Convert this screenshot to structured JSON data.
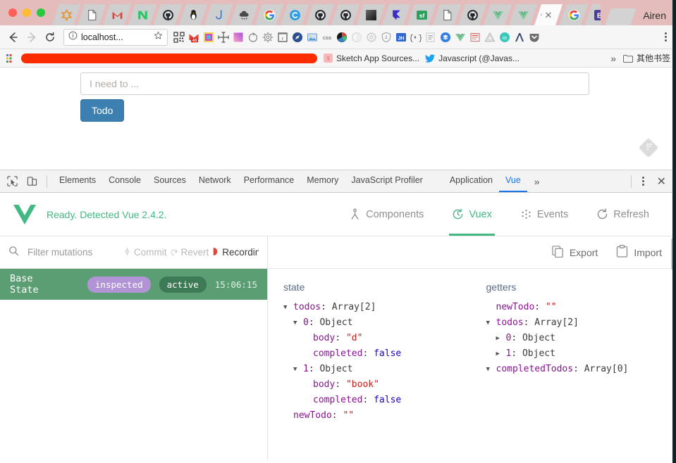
{
  "browser": {
    "profile_label": "Airen",
    "tabs": [
      {
        "icon": "slack-icon",
        "active": false
      },
      {
        "icon": "document-icon",
        "active": false
      },
      {
        "icon": "gmail-m-icon",
        "active": false
      },
      {
        "icon": "medium-n-icon",
        "active": false
      },
      {
        "icon": "github-icon",
        "active": false
      },
      {
        "icon": "penguin-icon",
        "active": false
      },
      {
        "icon": "moon-icon",
        "active": false
      },
      {
        "icon": "cloud-icon",
        "active": false
      },
      {
        "icon": "google-g-icon",
        "active": false
      },
      {
        "icon": "c-circle-icon",
        "active": false
      },
      {
        "icon": "github-icon",
        "active": false
      },
      {
        "icon": "github-icon",
        "active": false
      },
      {
        "icon": "dark-square-icon",
        "active": false
      },
      {
        "icon": "framer-f-icon",
        "active": false
      },
      {
        "icon": "sf-green-icon",
        "active": false
      },
      {
        "icon": "document-icon",
        "active": false
      },
      {
        "icon": "github-icon",
        "active": false
      },
      {
        "icon": "vue-icon",
        "active": false
      },
      {
        "icon": "vue-icon",
        "active": false
      },
      {
        "icon": "close-icon",
        "active": true
      },
      {
        "icon": "google-g-icon",
        "active": false
      },
      {
        "icon": "b-purple-icon",
        "active": false
      },
      {
        "icon": "document-icon",
        "active": false
      },
      {
        "icon": "w3c-icon",
        "active": false
      }
    ],
    "nav": {
      "back": "back-arrow-icon",
      "forward": "forward-arrow-icon",
      "reload": "reload-icon",
      "url": "localhost...",
      "info_icon": "info-circle-icon",
      "star_icon": "star-icon",
      "menu_icon": "kebab-menu-icon"
    },
    "extensions": [
      "qr-code-icon",
      "gmail-badge-icon",
      "colorpicker-icon",
      "crosshair-icon",
      "gradient-icon",
      "refresh-circle-icon",
      "gear-icon",
      "ruler-icon",
      "compass-icon",
      "image-icon",
      "css-icon",
      "color-wheel-icon",
      "half-circle-icon",
      "atom-icon",
      "shield-icon",
      "jh-icon",
      "braces-icon",
      "list-icon",
      "layers-blue-icon",
      "vue-icon",
      "note-icon",
      "triangle-icon",
      "m-circle-icon",
      "lambda-icon",
      "pocket-icon"
    ],
    "gmail_badge": "43",
    "bookmarks": {
      "redacted_label": "",
      "items": [
        {
          "label": "Sketch App Sources...",
          "icon": "sketch-icon"
        },
        {
          "label": "Javascript (@Javas...",
          "icon": "twitter-icon"
        }
      ],
      "overflow": "»",
      "other_label": "其他书签",
      "other_icon": "folder-icon"
    }
  },
  "page": {
    "input_placeholder": "I need to ...",
    "input_value": "",
    "submit_label": "Todo",
    "watermark_icon": "feedly-icon"
  },
  "devtools": {
    "inspect_icon": "inspect-cursor-icon",
    "device_icon": "device-toolbar-icon",
    "tabs": [
      {
        "label": "Elements",
        "selected": false
      },
      {
        "label": "Console",
        "selected": false
      },
      {
        "label": "Sources",
        "selected": false
      },
      {
        "label": "Network",
        "selected": false
      },
      {
        "label": "Performance",
        "selected": false
      },
      {
        "label": "Memory",
        "selected": false
      },
      {
        "label": "JavaScript Profiler",
        "selected": false
      },
      {
        "label": "Application",
        "selected": false
      },
      {
        "label": "Vue",
        "selected": true
      }
    ],
    "more_tabs": "»",
    "settings_icon": "kebab-menu-icon",
    "close_icon": "close-icon",
    "close_label": "✕"
  },
  "vue": {
    "logo_icon": "vue-logo-icon",
    "status": "Ready. Detected Vue 2.4.2.",
    "tabs": [
      {
        "label": "Components",
        "icon": "components-icon",
        "selected": false
      },
      {
        "label": "Vuex",
        "icon": "vuex-clock-icon",
        "selected": true
      },
      {
        "label": "Events",
        "icon": "events-icon",
        "selected": false
      },
      {
        "label": "Refresh",
        "icon": "refresh-icon",
        "selected": false
      }
    ]
  },
  "vuex": {
    "filter": {
      "icon": "search-icon",
      "placeholder": "Filter mutations",
      "value": ""
    },
    "actions": [
      {
        "label": "Commit",
        "icon": "commit-icon",
        "enabled": false
      },
      {
        "label": "Revert",
        "icon": "revert-icon",
        "enabled": false
      },
      {
        "label": "Recordin",
        "icon": "recording-icon",
        "enabled": true
      }
    ],
    "toolbar_right": [
      {
        "label": "Export",
        "icon": "export-icon"
      },
      {
        "label": "Import",
        "icon": "import-icon"
      }
    ],
    "history": [
      {
        "name": "Base State",
        "badges": [
          {
            "label": "inspected",
            "kind": "inspected"
          },
          {
            "label": "active",
            "kind": "active"
          }
        ],
        "time": "15:06:15",
        "selected": true
      }
    ],
    "state_pane": {
      "title": "state",
      "nodes": [
        {
          "indent": 0,
          "arrow": "down",
          "key": "todos",
          "sep": ": ",
          "value": "Array[2]",
          "vclass": "v-arr"
        },
        {
          "indent": 1,
          "arrow": "down",
          "key": "0",
          "sep": ": ",
          "value": "Object",
          "vclass": "v-obj"
        },
        {
          "indent": 2,
          "arrow": "none",
          "key": "body",
          "sep": ": ",
          "value": "\"d\"",
          "vclass": "v-str"
        },
        {
          "indent": 2,
          "arrow": "none",
          "key": "completed",
          "sep": ": ",
          "value": "false",
          "vclass": "v-bool"
        },
        {
          "indent": 1,
          "arrow": "down",
          "key": "1",
          "sep": ": ",
          "value": "Object",
          "vclass": "v-obj"
        },
        {
          "indent": 2,
          "arrow": "none",
          "key": "body",
          "sep": ": ",
          "value": "\"book\"",
          "vclass": "v-str"
        },
        {
          "indent": 2,
          "arrow": "none",
          "key": "completed",
          "sep": ": ",
          "value": "false",
          "vclass": "v-bool"
        },
        {
          "indent": 0,
          "arrow": "none",
          "key": "newTodo",
          "sep": ": ",
          "value": "\"\"",
          "vclass": "v-str"
        }
      ]
    },
    "getters_pane": {
      "title": "getters",
      "nodes": [
        {
          "indent": 0,
          "arrow": "none",
          "key": "newTodo",
          "sep": ": ",
          "value": "\"\"",
          "vclass": "v-str"
        },
        {
          "indent": 0,
          "arrow": "down",
          "key": "todos",
          "sep": ": ",
          "value": "Array[2]",
          "vclass": "v-arr"
        },
        {
          "indent": 1,
          "arrow": "right",
          "key": "0",
          "sep": ": ",
          "value": "Object",
          "vclass": "v-obj"
        },
        {
          "indent": 1,
          "arrow": "right",
          "key": "1",
          "sep": ": ",
          "value": "Object",
          "vclass": "v-obj"
        },
        {
          "indent": 0,
          "arrow": "down",
          "key": "completedTodos",
          "sep": ": ",
          "value": "Array[0]",
          "vclass": "v-arr"
        }
      ]
    }
  },
  "colors": {
    "vue_green": "#42b883",
    "state_row_green": "#5c9e73",
    "inspected_purple": "#b294d6",
    "active_dark_green": "#3d7a56",
    "devtools_blue": "#1a73e8",
    "todo_button_blue": "#3c7fb1",
    "redacted_red": "#fd2b00",
    "titlebar_pink": "#e5bcbc"
  }
}
